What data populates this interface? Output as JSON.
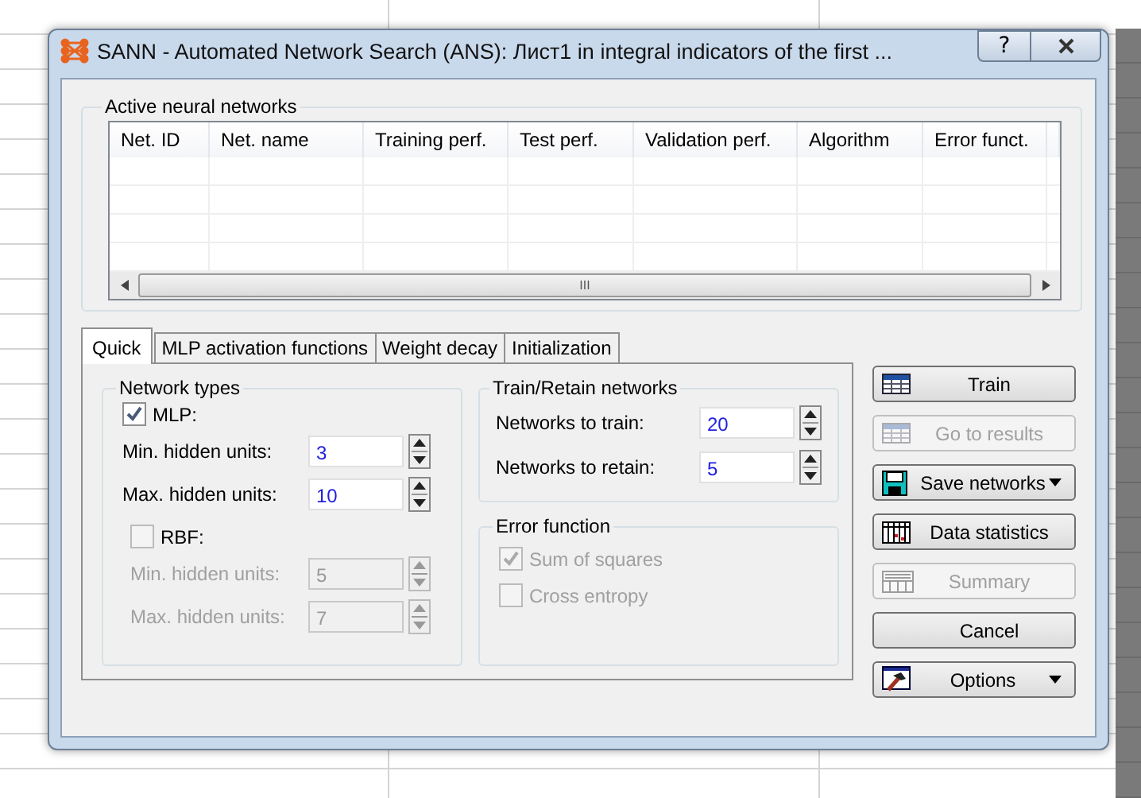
{
  "window": {
    "title": "SANN - Automated Network Search (ANS): Лист1 in integral indicators of the first ...",
    "help": "?"
  },
  "networks": {
    "label": "Active neural networks",
    "columns": [
      "Net. ID",
      "Net. name",
      "Training perf.",
      "Test perf.",
      "Validation perf.",
      "Algorithm",
      "Error funct."
    ],
    "scrollbar_grip": "III"
  },
  "tabs": [
    {
      "label": "Quick",
      "selected": true
    },
    {
      "label": "MLP activation functions",
      "selected": false
    },
    {
      "label": "Weight decay",
      "selected": false
    },
    {
      "label": "Initialization",
      "selected": false
    }
  ],
  "network_types": {
    "label": "Network types",
    "groups": [
      {
        "label": "MLP:",
        "checked": true,
        "disabled": false,
        "fields": [
          {
            "label": "Min. hidden units:",
            "value": "3"
          },
          {
            "label": "Max. hidden units:",
            "value": "10"
          }
        ]
      },
      {
        "label": "RBF:",
        "checked": false,
        "disabled": true,
        "fields": [
          {
            "label": "Min. hidden units:",
            "value": "5"
          },
          {
            "label": "Max. hidden units:",
            "value": "7"
          }
        ]
      }
    ]
  },
  "train_retain": {
    "label": "Train/Retain networks",
    "fields": [
      {
        "label": "Networks to train:",
        "value": "20"
      },
      {
        "label": "Networks to retain:",
        "value": "5"
      }
    ]
  },
  "error_function": {
    "label": "Error function",
    "options": [
      {
        "label": "Sum of squares",
        "checked": true,
        "disabled": true
      },
      {
        "label": "Cross entropy",
        "checked": false,
        "disabled": true
      }
    ]
  },
  "buttons": [
    {
      "label": "Train",
      "kind": "grid",
      "disabled": false,
      "dropdown": false
    },
    {
      "label": "Go to results",
      "kind": "grid",
      "disabled": true,
      "dropdown": false
    },
    {
      "label": "Save networks",
      "kind": "disk",
      "disabled": false,
      "dropdown": true
    },
    {
      "label": "Data statistics",
      "kind": "table",
      "disabled": false,
      "dropdown": false
    },
    {
      "label": "Summary",
      "kind": "summary",
      "disabled": true,
      "dropdown": false
    },
    {
      "label": "Cancel",
      "kind": "plain",
      "disabled": false,
      "dropdown": false
    },
    {
      "label": "Options",
      "kind": "hammer",
      "disabled": false,
      "dropdown": true
    }
  ]
}
